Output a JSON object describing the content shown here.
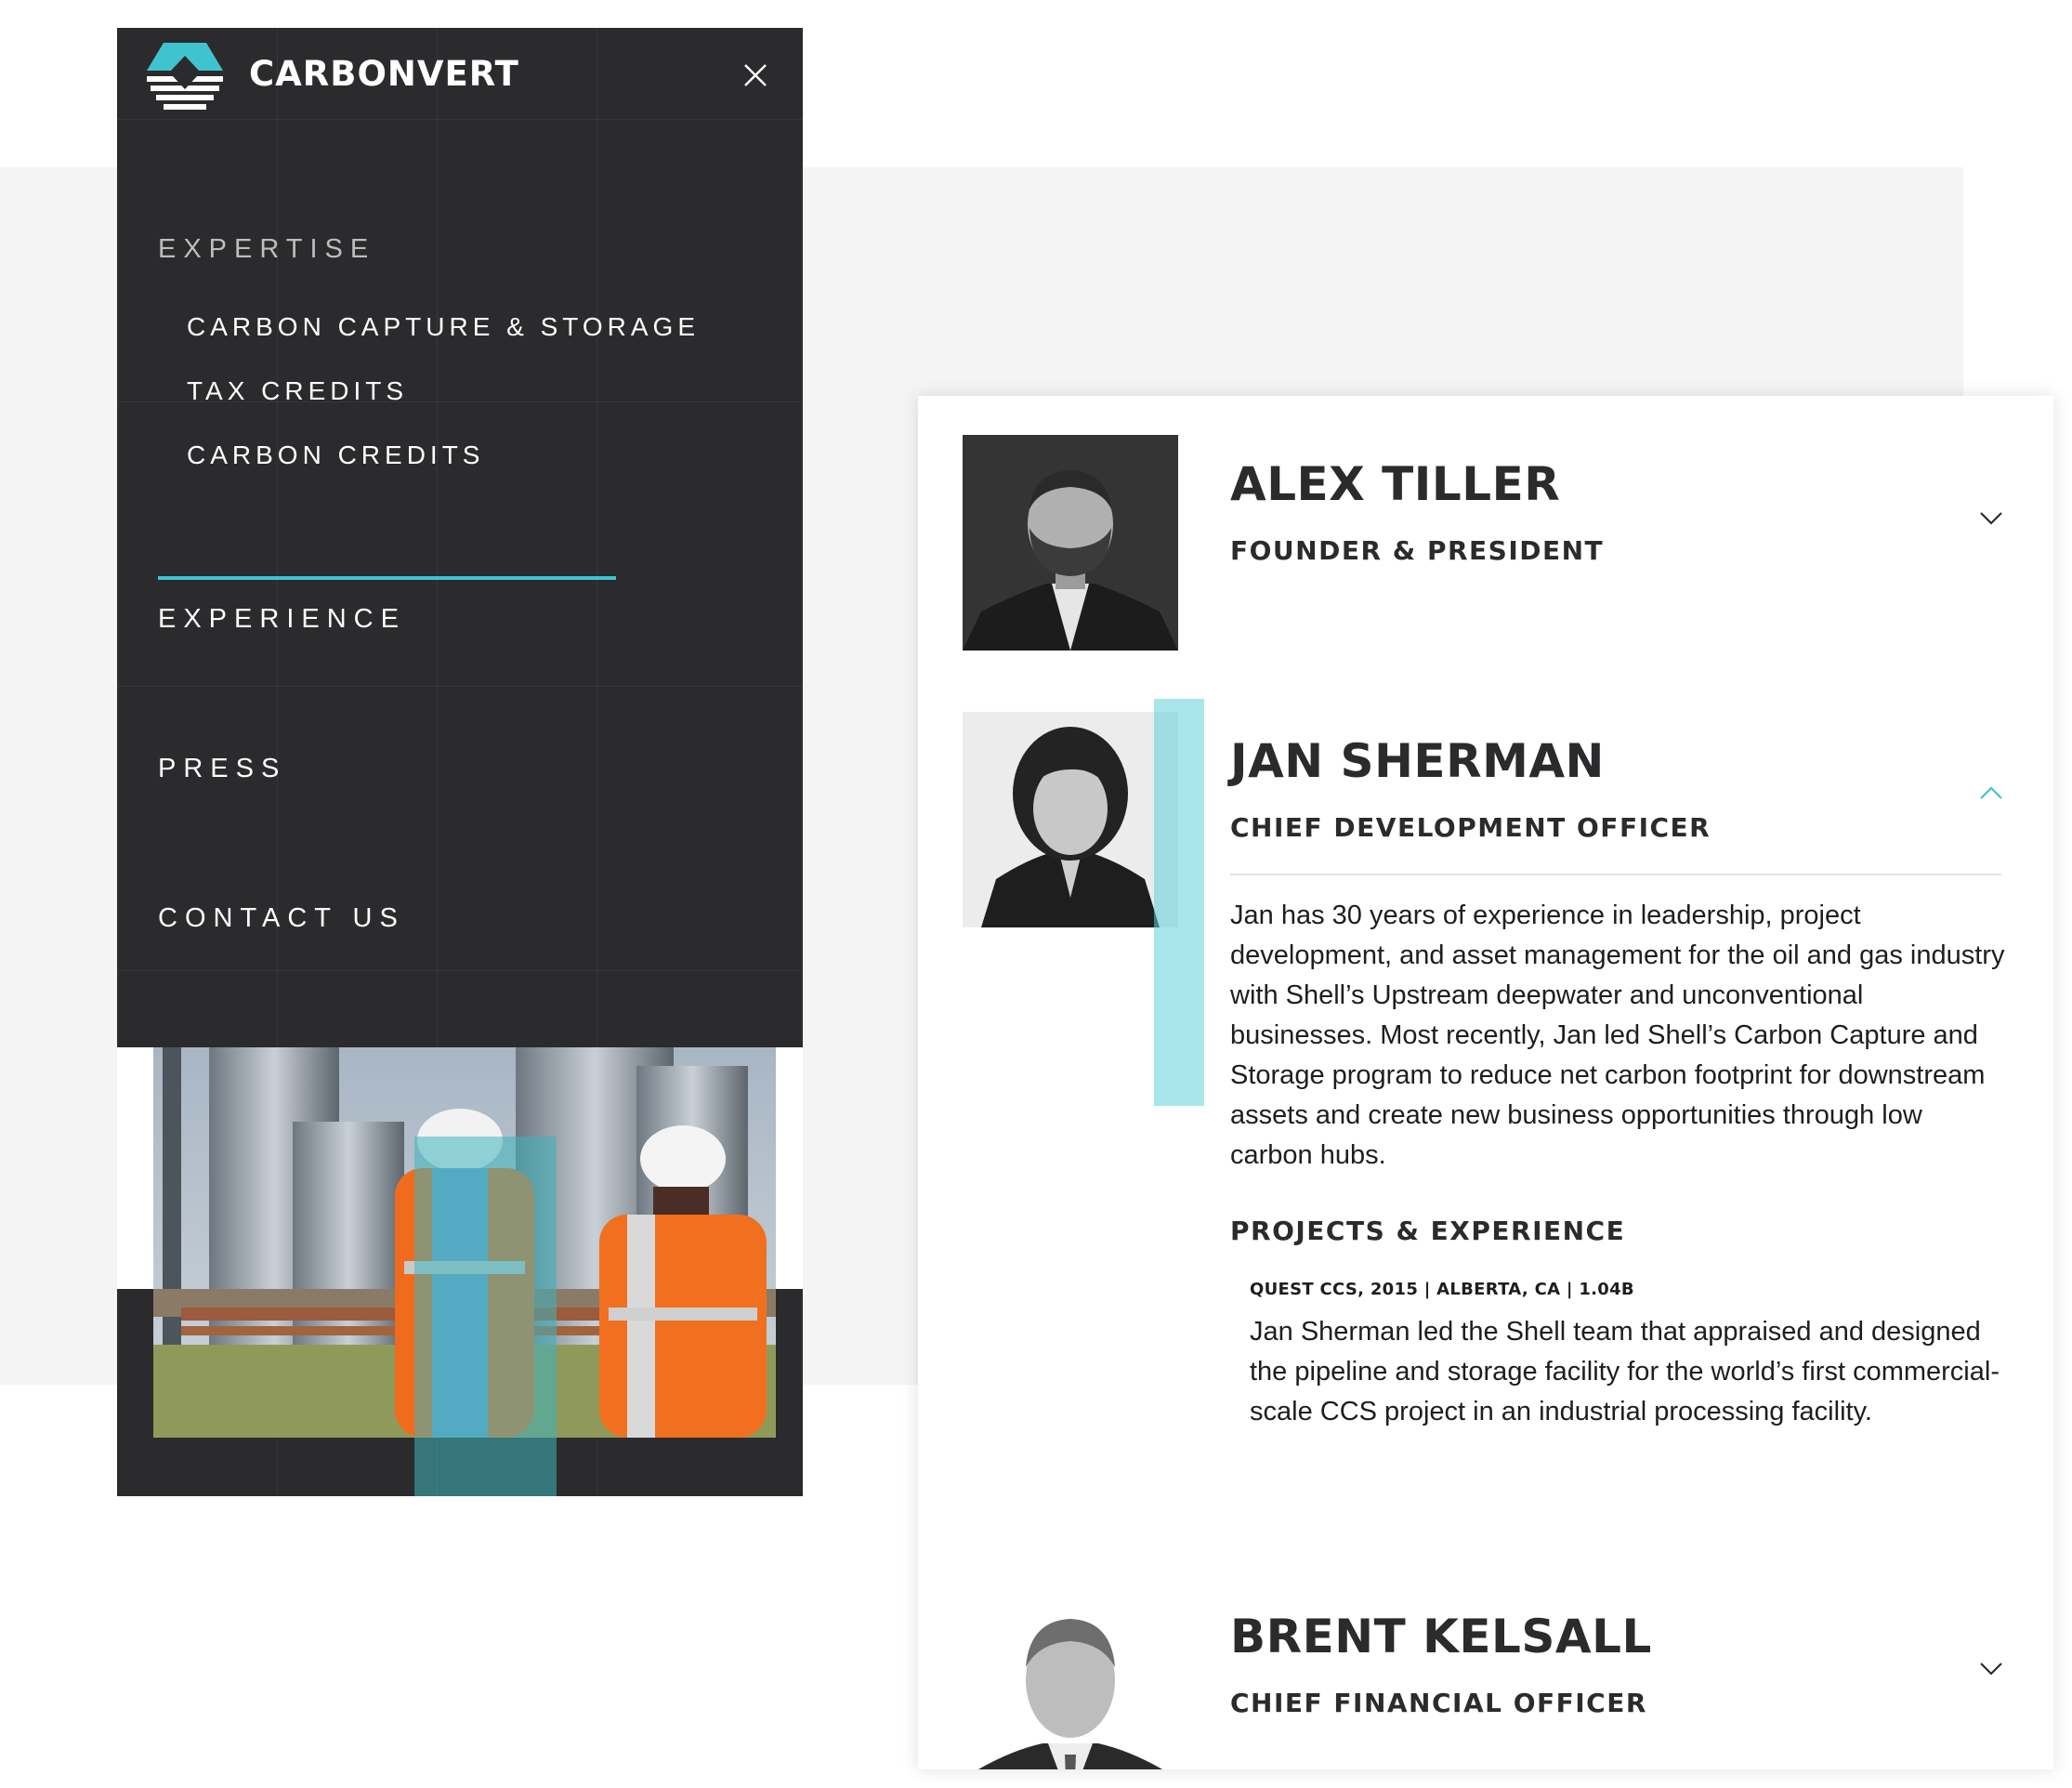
{
  "brand": {
    "name": "CARBONVERT",
    "accent": "#3fc4cf"
  },
  "menu": {
    "close_icon": "close-icon",
    "expertise": {
      "label": "EXPERTISE",
      "items": [
        "CARBON CAPTURE & STORAGE",
        "TAX CREDITS",
        "CARBON CREDITS"
      ]
    },
    "experience": "EXPERIENCE",
    "press": "PRESS",
    "contact": "CONTACT US"
  },
  "team": [
    {
      "name": "ALEX TILLER",
      "role": "FOUNDER & PRESIDENT",
      "expanded": false
    },
    {
      "name": "JAN SHERMAN",
      "role": "CHIEF DEVELOPMENT OFFICER",
      "expanded": true,
      "bio": "Jan has 30 years of experience in leadership, project development, and asset management for the oil and gas industry with Shell’s Upstream deepwater and unconventional businesses. Most recently, Jan led Shell’s Carbon Capture and Storage program to reduce net carbon footprint for downstream assets and create new business opportunities through low carbon hubs.",
      "projects_title": "PROJECTS & EXPERIENCE",
      "project": {
        "meta": "QUEST CCS, 2015 | ALBERTA, CA | 1.04B",
        "text": "Jan Sherman led the Shell team that appraised and designed the pipeline and storage facility for the world’s first commercial-scale CCS project in an industrial processing facility."
      }
    },
    {
      "name": "BRENT KELSALL",
      "role": "CHIEF FINANCIAL OFFICER",
      "expanded": false
    }
  ]
}
